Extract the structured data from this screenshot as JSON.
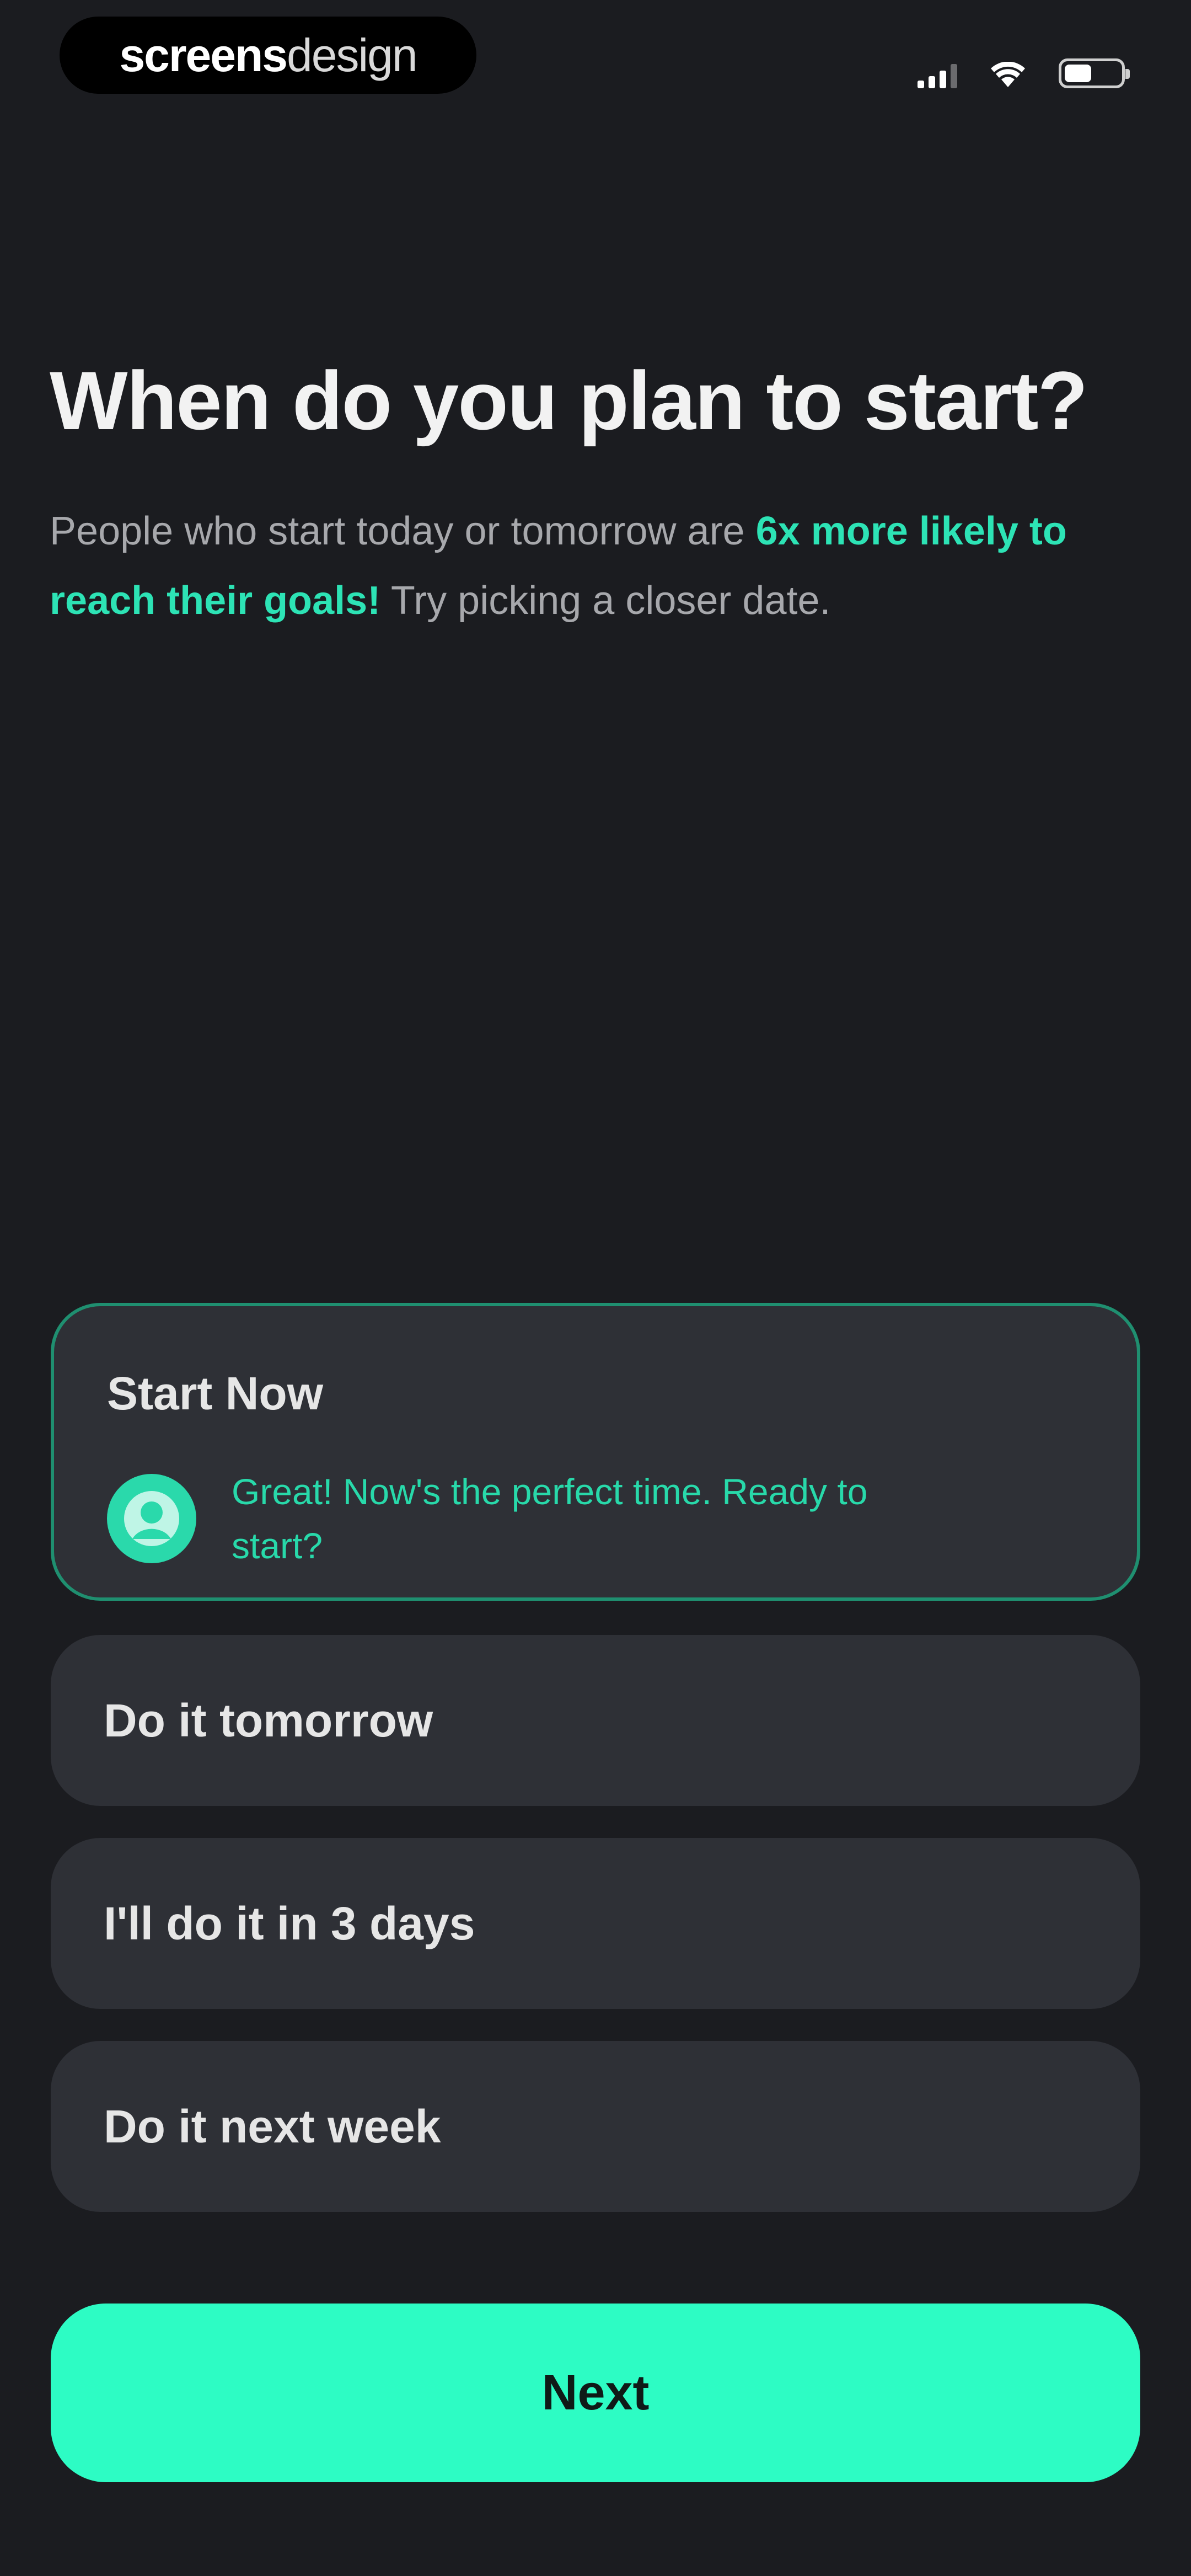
{
  "status_bar": {
    "brand_bold": "screens",
    "brand_light": "design"
  },
  "header": {
    "title": "When do you plan to start?",
    "subtitle_lead": "People who start today or tomorrow are ",
    "subtitle_highlight": "6x more likely to reach their goals!",
    "subtitle_tail": " Try picking a closer date."
  },
  "options": [
    {
      "label": "Start Now",
      "selected": true,
      "feedback": "Great! Now's the perfect time. Ready to start?"
    },
    {
      "label": "Do it tomorrow",
      "selected": false
    },
    {
      "label": "I'll do it in 3 days",
      "selected": false
    },
    {
      "label": "Do it next week",
      "selected": false
    }
  ],
  "actions": {
    "next_label": "Next"
  },
  "icons": {
    "signal": "cellular-signal-icon",
    "wifi": "wifi-icon",
    "battery": "battery-icon",
    "avatar": "coach-avatar-icon"
  },
  "colors": {
    "background": "#1b1c20",
    "card": "#2e3036",
    "accent": "#2dfcc4",
    "highlight": "#2de3b5",
    "selected_border": "#1f8f70"
  }
}
